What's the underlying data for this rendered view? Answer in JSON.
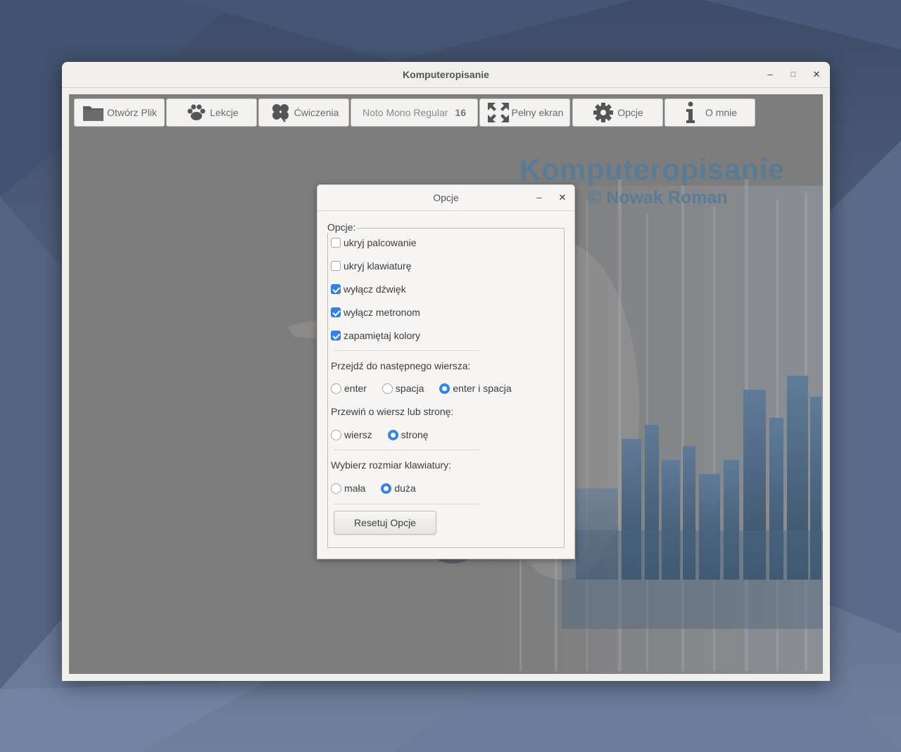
{
  "window": {
    "title": "Komputeropisanie",
    "minimize": "–",
    "maximize": "□",
    "close": "✕"
  },
  "toolbar": {
    "open_file": "Otwórz Plik",
    "lessons": "Lekcje",
    "exercises": "Ćwiczenia",
    "font_name": "Noto Mono Regular",
    "font_size": "16",
    "fullscreen": "Pełny ekran",
    "options": "Opcje",
    "about": "O mnie",
    "icons": [
      "folder-icon",
      "paw-icon",
      "clover-icon",
      "fullscreen-icon",
      "gear-icon",
      "info-icon"
    ]
  },
  "background": {
    "brand": "Komputeropisanie",
    "author": "© Nowak Roman",
    "brand_color": "#5b7b95"
  },
  "dialog": {
    "title": "Opcje",
    "minimize": "–",
    "close": "✕",
    "group_label": "Opcje:",
    "checkboxes": [
      {
        "label": "ukryj palcowanie",
        "checked": false
      },
      {
        "label": "ukryj klawiaturę",
        "checked": false
      },
      {
        "label": "wyłącz dźwięk",
        "checked": true
      },
      {
        "label": "wyłącz metronom",
        "checked": true
      },
      {
        "label": "zapamiętaj kolory",
        "checked": true
      }
    ],
    "next_line": {
      "label": "Przejdź do następnego wiersza:",
      "options": [
        "enter",
        "spacja",
        "enter i spacja"
      ],
      "selected": "enter i spacja"
    },
    "scroll": {
      "label": "Przewiń o wiersz lub stronę:",
      "options": [
        "wiersz",
        "stronę"
      ],
      "selected": "stronę"
    },
    "keyboard_size": {
      "label": "Wybierz rozmiar klawiatury:",
      "options": [
        "mała",
        "duża"
      ],
      "selected": "duża"
    },
    "reset_label": "Resetuj Opcje",
    "accent_color": "#3584e4"
  }
}
